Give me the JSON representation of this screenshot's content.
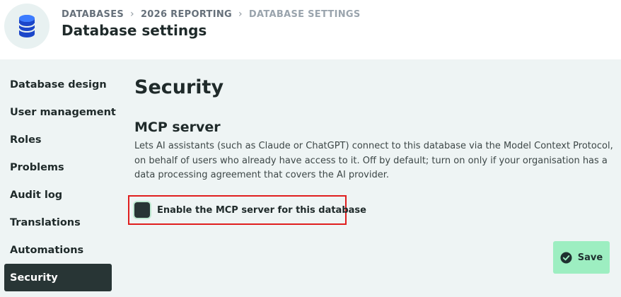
{
  "breadcrumb": {
    "items": [
      "DATABASES",
      "2026 REPORTING",
      "DATABASE SETTINGS"
    ],
    "separator": "›"
  },
  "page_title": "Database settings",
  "sidebar": {
    "items": [
      {
        "label": "Database design",
        "active": false
      },
      {
        "label": "User management",
        "active": false
      },
      {
        "label": "Roles",
        "active": false
      },
      {
        "label": "Problems",
        "active": false
      },
      {
        "label": "Audit log",
        "active": false
      },
      {
        "label": "Translations",
        "active": false
      },
      {
        "label": "Automations",
        "active": false
      },
      {
        "label": "Security",
        "active": true
      }
    ]
  },
  "main": {
    "section_title": "Security",
    "mcp": {
      "title": "MCP server",
      "description": "Lets AI assistants (such as Claude or ChatGPT) connect to this database via the Model Context Protocol, on behalf of users who already have access to it. Off by default; turn on only if your organisation has a data processing agreement that covers the AI provider.",
      "checkbox_label": "Enable the MCP server for this database",
      "checked": false
    }
  },
  "save_button": {
    "label": "Save"
  },
  "icons": {
    "logo": "database-icon",
    "save": "check-circle-icon"
  },
  "colors": {
    "accent_dark": "#283535",
    "save_green": "#9deec1",
    "highlight_red": "#e01e1e",
    "database_blue": "#1b46c9"
  }
}
